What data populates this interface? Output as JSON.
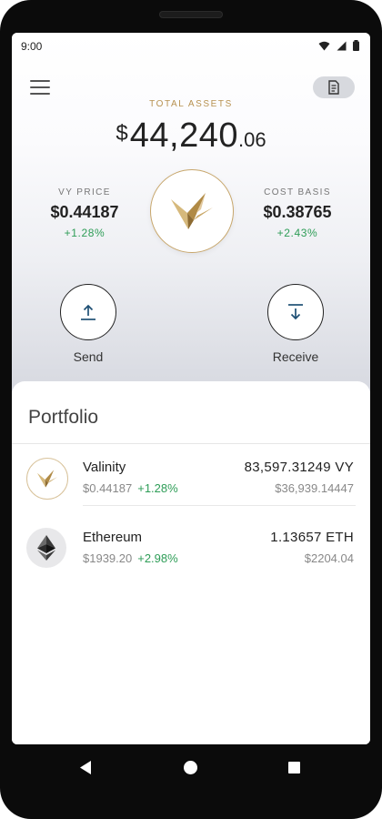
{
  "status": {
    "time": "9:00"
  },
  "header": {
    "total_label": "TOTAL ASSETS",
    "currency_symbol": "$",
    "total_whole": "44,240",
    "total_decimal": ".06"
  },
  "stats": {
    "vy_price": {
      "label": "VY PRICE",
      "value": "$0.44187",
      "change": "+1.28%"
    },
    "cost_basis": {
      "label": "COST BASIS",
      "value": "$0.38765",
      "change": "+2.43%"
    }
  },
  "actions": {
    "send_label": "Send",
    "receive_label": "Receive"
  },
  "portfolio": {
    "title": "Portfolio",
    "assets": [
      {
        "name": "Valinity",
        "price": "$0.44187",
        "change": "+1.28%",
        "amount": "83,597.31249 VY",
        "usd": "$36,939.14447"
      },
      {
        "name": "Ethereum",
        "price": "$1939.20",
        "change": "+2.98%",
        "amount": "1.13657 ETH",
        "usd": "$2204.04"
      }
    ]
  },
  "colors": {
    "accent_gold": "#b79150",
    "positive": "#2e9d57"
  }
}
